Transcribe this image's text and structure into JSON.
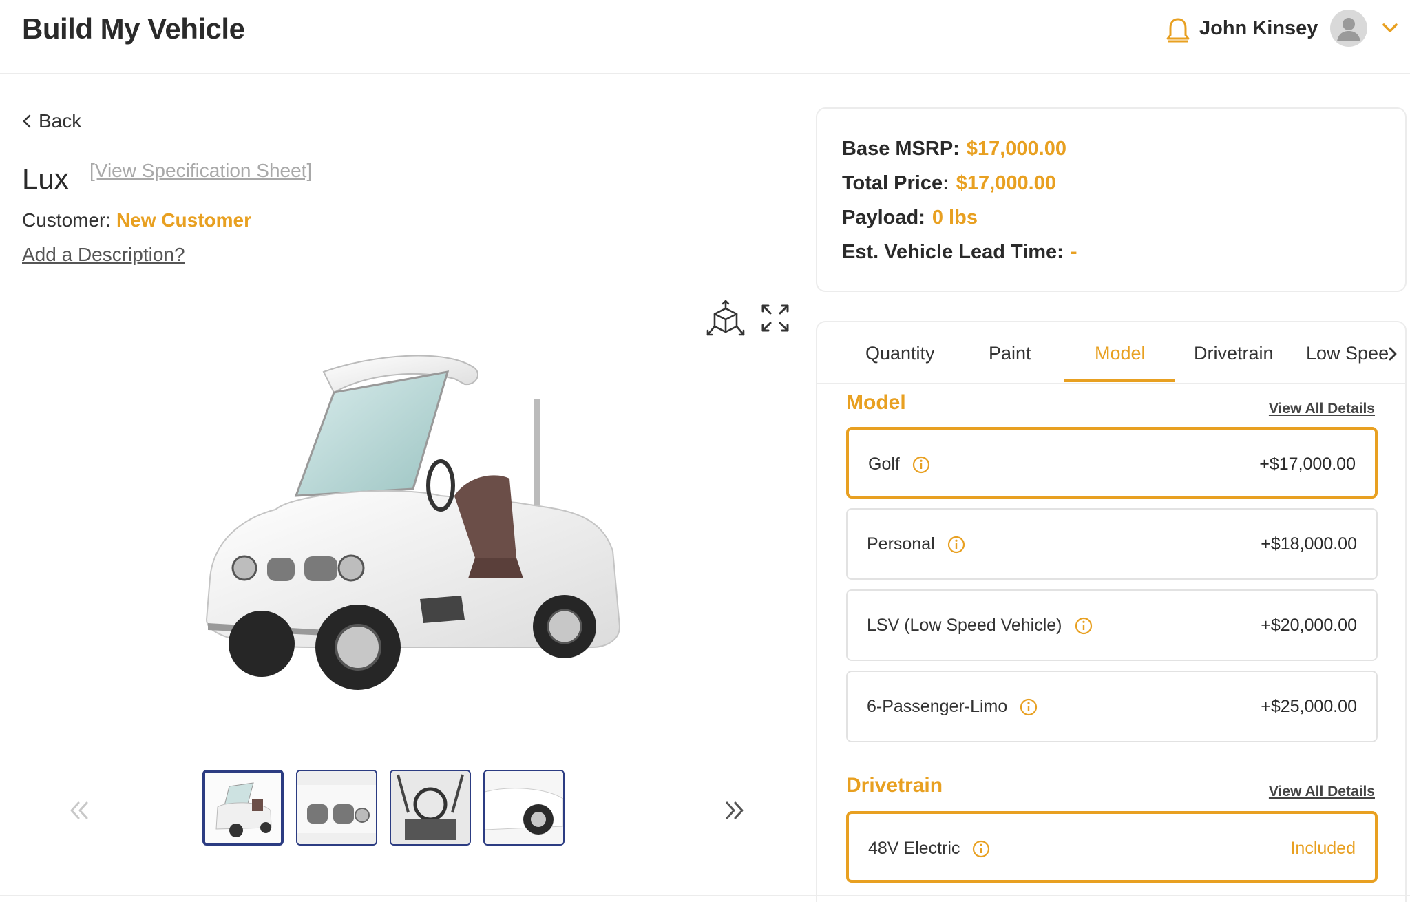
{
  "header": {
    "title": "Build My Vehicle",
    "user_name": "John Kinsey"
  },
  "left": {
    "back_label": "Back",
    "vehicle_name": "Lux",
    "spec_sheet_link": "[View Specification Sheet]",
    "customer_label": "Customer:",
    "customer_value": "New Customer",
    "add_description": "Add a Description?",
    "thumbnail_count": 4,
    "active_thumbnail": 1
  },
  "pricing": {
    "base_msrp_label": "Base MSRP:",
    "base_msrp_value": "$17,000.00",
    "total_price_label": "Total Price:",
    "total_price_value": "$17,000.00",
    "payload_label": "Payload:",
    "payload_value": "0 lbs",
    "lead_time_label": "Est. Vehicle Lead Time:",
    "lead_time_value": "-"
  },
  "tabs": [
    {
      "label": "Quantity"
    },
    {
      "label": "Paint"
    },
    {
      "label": "Model"
    },
    {
      "label": "Drivetrain"
    },
    {
      "label": "Low Spee"
    }
  ],
  "active_tab": "Model",
  "model_section": {
    "title": "Model",
    "view_all": "View All Details",
    "options": [
      {
        "label": "Golf",
        "price": "+$17,000.00",
        "selected": true
      },
      {
        "label": "Personal",
        "price": "+$18,000.00",
        "selected": false
      },
      {
        "label": "LSV (Low Speed Vehicle)",
        "price": "+$20,000.00",
        "selected": false
      },
      {
        "label": "6-Passenger-Limo",
        "price": "+$25,000.00",
        "selected": false
      }
    ]
  },
  "drivetrain_section": {
    "title": "Drivetrain",
    "view_all": "View All Details",
    "options": [
      {
        "label": "48V Electric",
        "price": "Included",
        "selected": true
      }
    ]
  },
  "colors": {
    "accent": "#e8a021",
    "thumb_border": "#2c3c82",
    "border": "#ececec"
  }
}
